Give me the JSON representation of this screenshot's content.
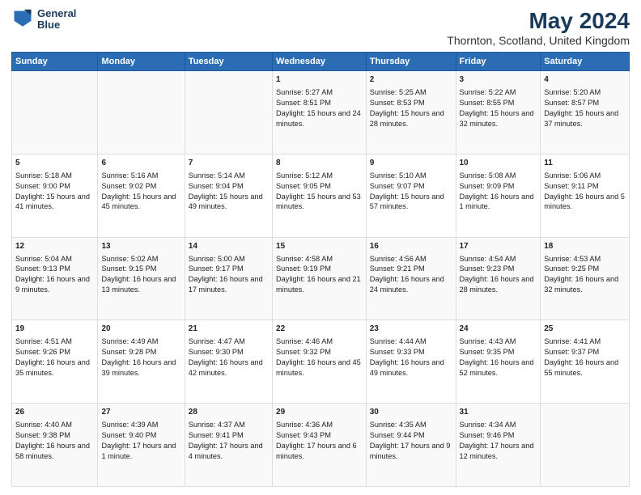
{
  "header": {
    "logo_line1": "General",
    "logo_line2": "Blue",
    "main_title": "May 2024",
    "subtitle": "Thornton, Scotland, United Kingdom"
  },
  "columns": [
    "Sunday",
    "Monday",
    "Tuesday",
    "Wednesday",
    "Thursday",
    "Friday",
    "Saturday"
  ],
  "weeks": [
    [
      {
        "num": "",
        "info": ""
      },
      {
        "num": "",
        "info": ""
      },
      {
        "num": "",
        "info": ""
      },
      {
        "num": "1",
        "info": "Sunrise: 5:27 AM\nSunset: 8:51 PM\nDaylight: 15 hours and 24 minutes."
      },
      {
        "num": "2",
        "info": "Sunrise: 5:25 AM\nSunset: 8:53 PM\nDaylight: 15 hours and 28 minutes."
      },
      {
        "num": "3",
        "info": "Sunrise: 5:22 AM\nSunset: 8:55 PM\nDaylight: 15 hours and 32 minutes."
      },
      {
        "num": "4",
        "info": "Sunrise: 5:20 AM\nSunset: 8:57 PM\nDaylight: 15 hours and 37 minutes."
      }
    ],
    [
      {
        "num": "5",
        "info": "Sunrise: 5:18 AM\nSunset: 9:00 PM\nDaylight: 15 hours and 41 minutes."
      },
      {
        "num": "6",
        "info": "Sunrise: 5:16 AM\nSunset: 9:02 PM\nDaylight: 15 hours and 45 minutes."
      },
      {
        "num": "7",
        "info": "Sunrise: 5:14 AM\nSunset: 9:04 PM\nDaylight: 15 hours and 49 minutes."
      },
      {
        "num": "8",
        "info": "Sunrise: 5:12 AM\nSunset: 9:05 PM\nDaylight: 15 hours and 53 minutes."
      },
      {
        "num": "9",
        "info": "Sunrise: 5:10 AM\nSunset: 9:07 PM\nDaylight: 15 hours and 57 minutes."
      },
      {
        "num": "10",
        "info": "Sunrise: 5:08 AM\nSunset: 9:09 PM\nDaylight: 16 hours and 1 minute."
      },
      {
        "num": "11",
        "info": "Sunrise: 5:06 AM\nSunset: 9:11 PM\nDaylight: 16 hours and 5 minutes."
      }
    ],
    [
      {
        "num": "12",
        "info": "Sunrise: 5:04 AM\nSunset: 9:13 PM\nDaylight: 16 hours and 9 minutes."
      },
      {
        "num": "13",
        "info": "Sunrise: 5:02 AM\nSunset: 9:15 PM\nDaylight: 16 hours and 13 minutes."
      },
      {
        "num": "14",
        "info": "Sunrise: 5:00 AM\nSunset: 9:17 PM\nDaylight: 16 hours and 17 minutes."
      },
      {
        "num": "15",
        "info": "Sunrise: 4:58 AM\nSunset: 9:19 PM\nDaylight: 16 hours and 21 minutes."
      },
      {
        "num": "16",
        "info": "Sunrise: 4:56 AM\nSunset: 9:21 PM\nDaylight: 16 hours and 24 minutes."
      },
      {
        "num": "17",
        "info": "Sunrise: 4:54 AM\nSunset: 9:23 PM\nDaylight: 16 hours and 28 minutes."
      },
      {
        "num": "18",
        "info": "Sunrise: 4:53 AM\nSunset: 9:25 PM\nDaylight: 16 hours and 32 minutes."
      }
    ],
    [
      {
        "num": "19",
        "info": "Sunrise: 4:51 AM\nSunset: 9:26 PM\nDaylight: 16 hours and 35 minutes."
      },
      {
        "num": "20",
        "info": "Sunrise: 4:49 AM\nSunset: 9:28 PM\nDaylight: 16 hours and 39 minutes."
      },
      {
        "num": "21",
        "info": "Sunrise: 4:47 AM\nSunset: 9:30 PM\nDaylight: 16 hours and 42 minutes."
      },
      {
        "num": "22",
        "info": "Sunrise: 4:46 AM\nSunset: 9:32 PM\nDaylight: 16 hours and 45 minutes."
      },
      {
        "num": "23",
        "info": "Sunrise: 4:44 AM\nSunset: 9:33 PM\nDaylight: 16 hours and 49 minutes."
      },
      {
        "num": "24",
        "info": "Sunrise: 4:43 AM\nSunset: 9:35 PM\nDaylight: 16 hours and 52 minutes."
      },
      {
        "num": "25",
        "info": "Sunrise: 4:41 AM\nSunset: 9:37 PM\nDaylight: 16 hours and 55 minutes."
      }
    ],
    [
      {
        "num": "26",
        "info": "Sunrise: 4:40 AM\nSunset: 9:38 PM\nDaylight: 16 hours and 58 minutes."
      },
      {
        "num": "27",
        "info": "Sunrise: 4:39 AM\nSunset: 9:40 PM\nDaylight: 17 hours and 1 minute."
      },
      {
        "num": "28",
        "info": "Sunrise: 4:37 AM\nSunset: 9:41 PM\nDaylight: 17 hours and 4 minutes."
      },
      {
        "num": "29",
        "info": "Sunrise: 4:36 AM\nSunset: 9:43 PM\nDaylight: 17 hours and 6 minutes."
      },
      {
        "num": "30",
        "info": "Sunrise: 4:35 AM\nSunset: 9:44 PM\nDaylight: 17 hours and 9 minutes."
      },
      {
        "num": "31",
        "info": "Sunrise: 4:34 AM\nSunset: 9:46 PM\nDaylight: 17 hours and 12 minutes."
      },
      {
        "num": "",
        "info": ""
      }
    ]
  ]
}
